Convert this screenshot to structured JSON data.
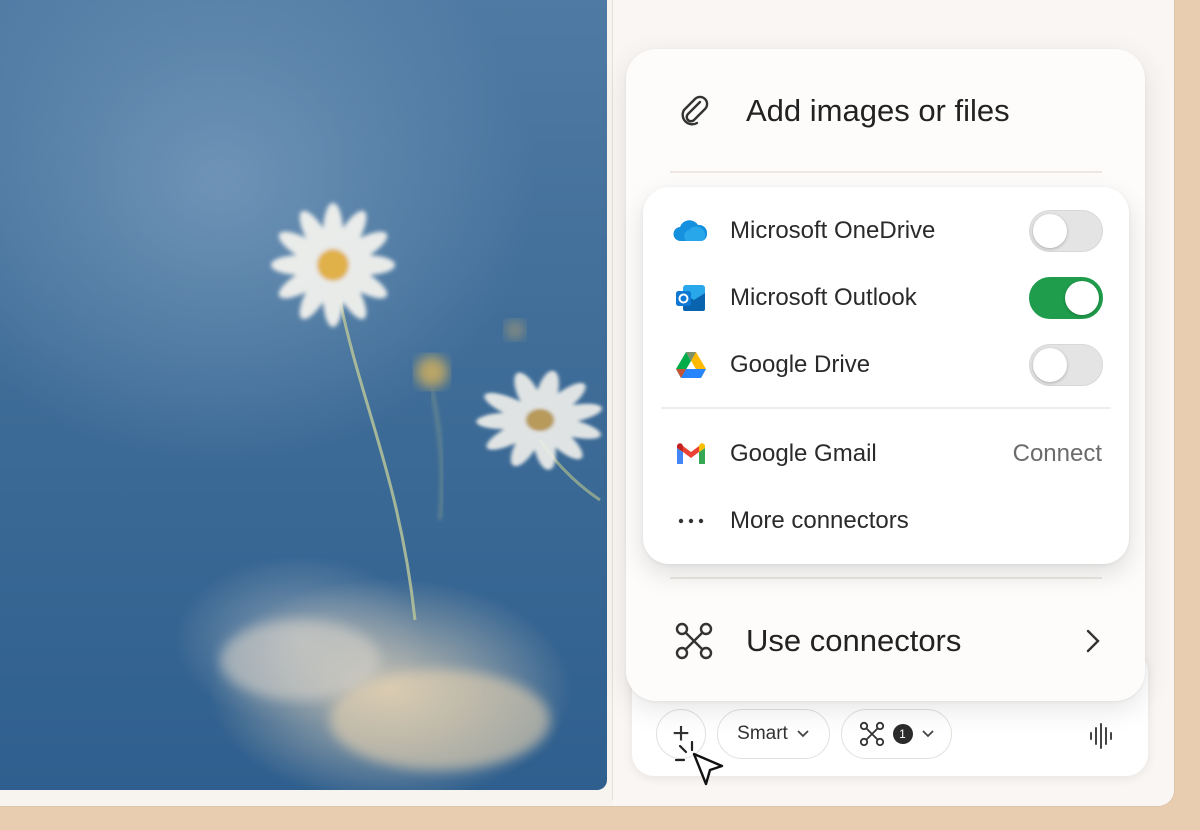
{
  "menu": {
    "add_files_label": "Add images or files",
    "use_connectors_label": "Use connectors"
  },
  "connectors": {
    "items": [
      {
        "label": "Microsoft OneDrive",
        "enabled": false,
        "icon": "onedrive-icon"
      },
      {
        "label": "Microsoft Outlook",
        "enabled": true,
        "icon": "outlook-icon"
      },
      {
        "label": "Google Drive",
        "enabled": false,
        "icon": "google-drive-icon"
      }
    ],
    "gmail_label": "Google Gmail",
    "gmail_action": "Connect",
    "more_label": "More connectors"
  },
  "composer": {
    "plus_label": "+",
    "mode_label": "Smart",
    "connector_count": "1"
  },
  "colors": {
    "toggle_on": "#1f9d4c",
    "toggle_off": "#e4e4e4",
    "frame": "#e8cdb0"
  }
}
